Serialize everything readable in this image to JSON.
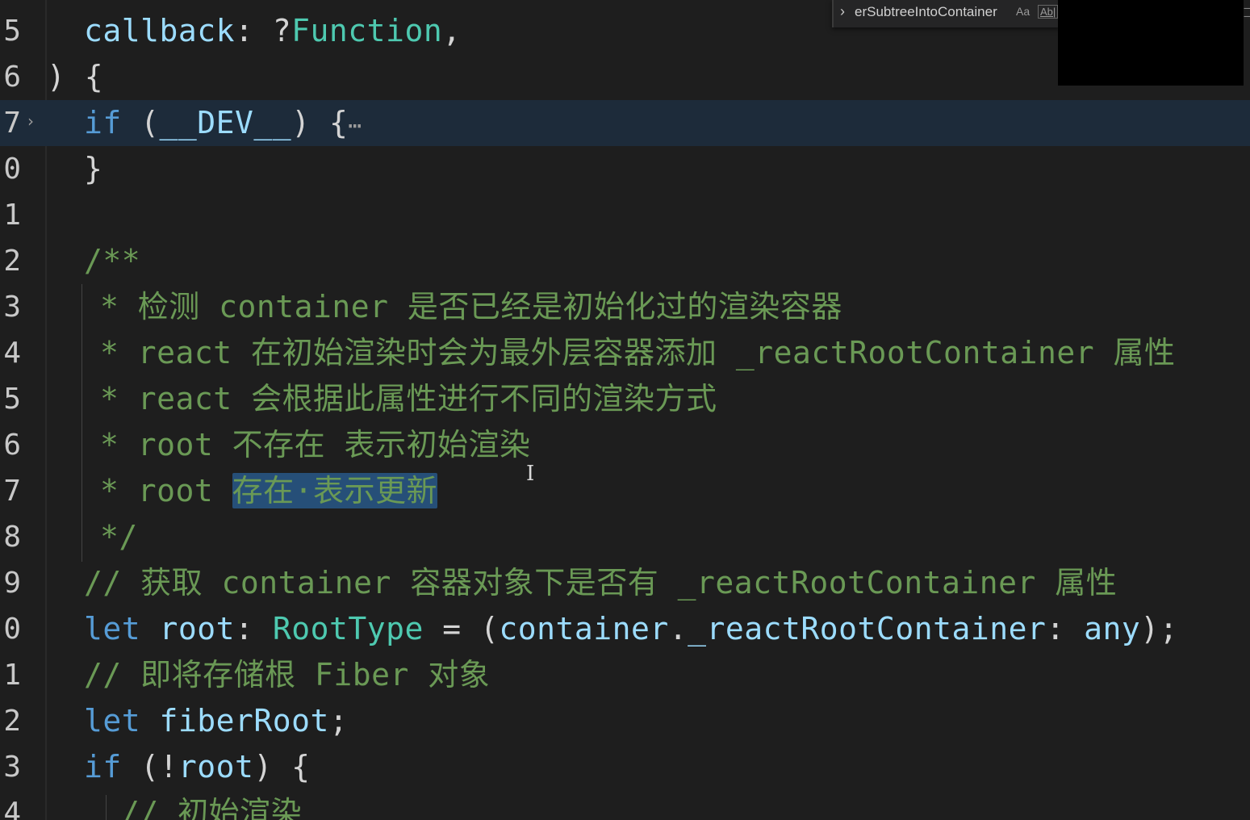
{
  "find_widget": {
    "query": "erSubtreeIntoContainer",
    "match_case_label": "Aa",
    "whole_word_label": "Ab|"
  },
  "editor": {
    "lines": [
      {
        "number": "5",
        "tokens": [
          [
            "vr",
            "callback"
          ],
          [
            "pn",
            ": ?"
          ],
          [
            "ty",
            "Function"
          ],
          [
            "pn",
            ","
          ]
        ]
      },
      {
        "number": "6",
        "tokens": [
          [
            "pn",
            ") {"
          ]
        ]
      },
      {
        "number": "7",
        "tokens": [
          [
            "kw",
            "if"
          ],
          [
            "pn",
            " ("
          ],
          [
            "vr",
            "__DEV__"
          ],
          [
            "pn",
            ") {"
          ]
        ]
      },
      {
        "number": "0",
        "tokens": [
          [
            "pn",
            "}"
          ]
        ]
      },
      {
        "number": "1",
        "tokens": []
      },
      {
        "number": "2",
        "tokens": [
          [
            "cm",
            "/**"
          ]
        ]
      },
      {
        "number": "3",
        "tokens": [
          [
            "cm",
            "* 检测 container 是否已经是初始化过的渲染容器"
          ]
        ]
      },
      {
        "number": "4",
        "tokens": [
          [
            "cm",
            "* react 在初始渲染时会为最外层容器添加 _reactRootContainer 属性"
          ]
        ]
      },
      {
        "number": "5",
        "tokens": [
          [
            "cm",
            "* react 会根据此属性进行不同的渲染方式"
          ]
        ]
      },
      {
        "number": "6",
        "tokens": [
          [
            "cm",
            "* root 不存在 表示初始渲染"
          ]
        ]
      },
      {
        "number": "7",
        "tokens": [
          [
            "cm",
            "* root "
          ],
          [
            "cm sel",
            "存在·表示更新"
          ]
        ]
      },
      {
        "number": "8",
        "tokens": [
          [
            "cm",
            "*/"
          ]
        ]
      },
      {
        "number": "9",
        "tokens": [
          [
            "cm",
            "// 获取 container 容器对象下是否有 _reactRootContainer 属性"
          ]
        ]
      },
      {
        "number": "0",
        "tokens": [
          [
            "kw",
            "let"
          ],
          [
            "pn",
            " "
          ],
          [
            "vr",
            "root"
          ],
          [
            "pn",
            ": "
          ],
          [
            "ty",
            "RootType"
          ],
          [
            "pn",
            " = ("
          ],
          [
            "vr",
            "container"
          ],
          [
            "pn",
            "."
          ],
          [
            "vr",
            "_reactRootContainer"
          ],
          [
            "pn",
            ": "
          ],
          [
            "vr",
            "any"
          ],
          [
            "pn",
            ");"
          ]
        ]
      },
      {
        "number": "1",
        "tokens": [
          [
            "cm",
            "// 即将存储根 Fiber 对象"
          ]
        ]
      },
      {
        "number": "2",
        "tokens": [
          [
            "kw",
            "let"
          ],
          [
            "pn",
            " "
          ],
          [
            "vr",
            "fiberRoot"
          ],
          [
            "pn",
            ";"
          ]
        ]
      },
      {
        "number": "3",
        "tokens": [
          [
            "kw",
            "if"
          ],
          [
            "pn",
            " (!"
          ],
          [
            "vr",
            "root"
          ],
          [
            "pn",
            ") {"
          ]
        ]
      },
      {
        "number": "4",
        "tokens": [
          [
            "cm",
            "// 初始渲染"
          ]
        ]
      }
    ],
    "collapsed_marker": "⋯",
    "fold_icon": "›"
  },
  "colors": {
    "background": "#1e1e1e",
    "keyword": "#569cd6",
    "type": "#4ec9b0",
    "variable": "#9cdcfe",
    "comment": "#6a9955",
    "selection": "#264f78"
  }
}
